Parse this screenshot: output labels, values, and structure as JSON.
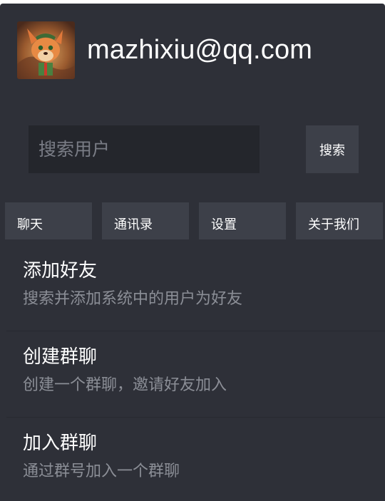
{
  "header": {
    "avatar_alt": "user avatar",
    "email": "mazhixiu@qq.com"
  },
  "search": {
    "placeholder": "搜索用户",
    "value": "",
    "button_label": "搜索"
  },
  "tabs": [
    {
      "label": "聊天"
    },
    {
      "label": "通讯录"
    },
    {
      "label": "设置"
    },
    {
      "label": "关于我们"
    }
  ],
  "actions": [
    {
      "title": "添加好友",
      "description": "搜索并添加系统中的用户为好友"
    },
    {
      "title": "创建群聊",
      "description": "创建一个群聊，邀请好友加入"
    },
    {
      "title": "加入群聊",
      "description": "通过群号加入一个群聊"
    }
  ],
  "colors": {
    "panel_background": "#2e3038",
    "control_background": "#3d4049",
    "input_background": "#24262c",
    "primary_text": "#ffffff",
    "secondary_text": "#8b8e96"
  }
}
